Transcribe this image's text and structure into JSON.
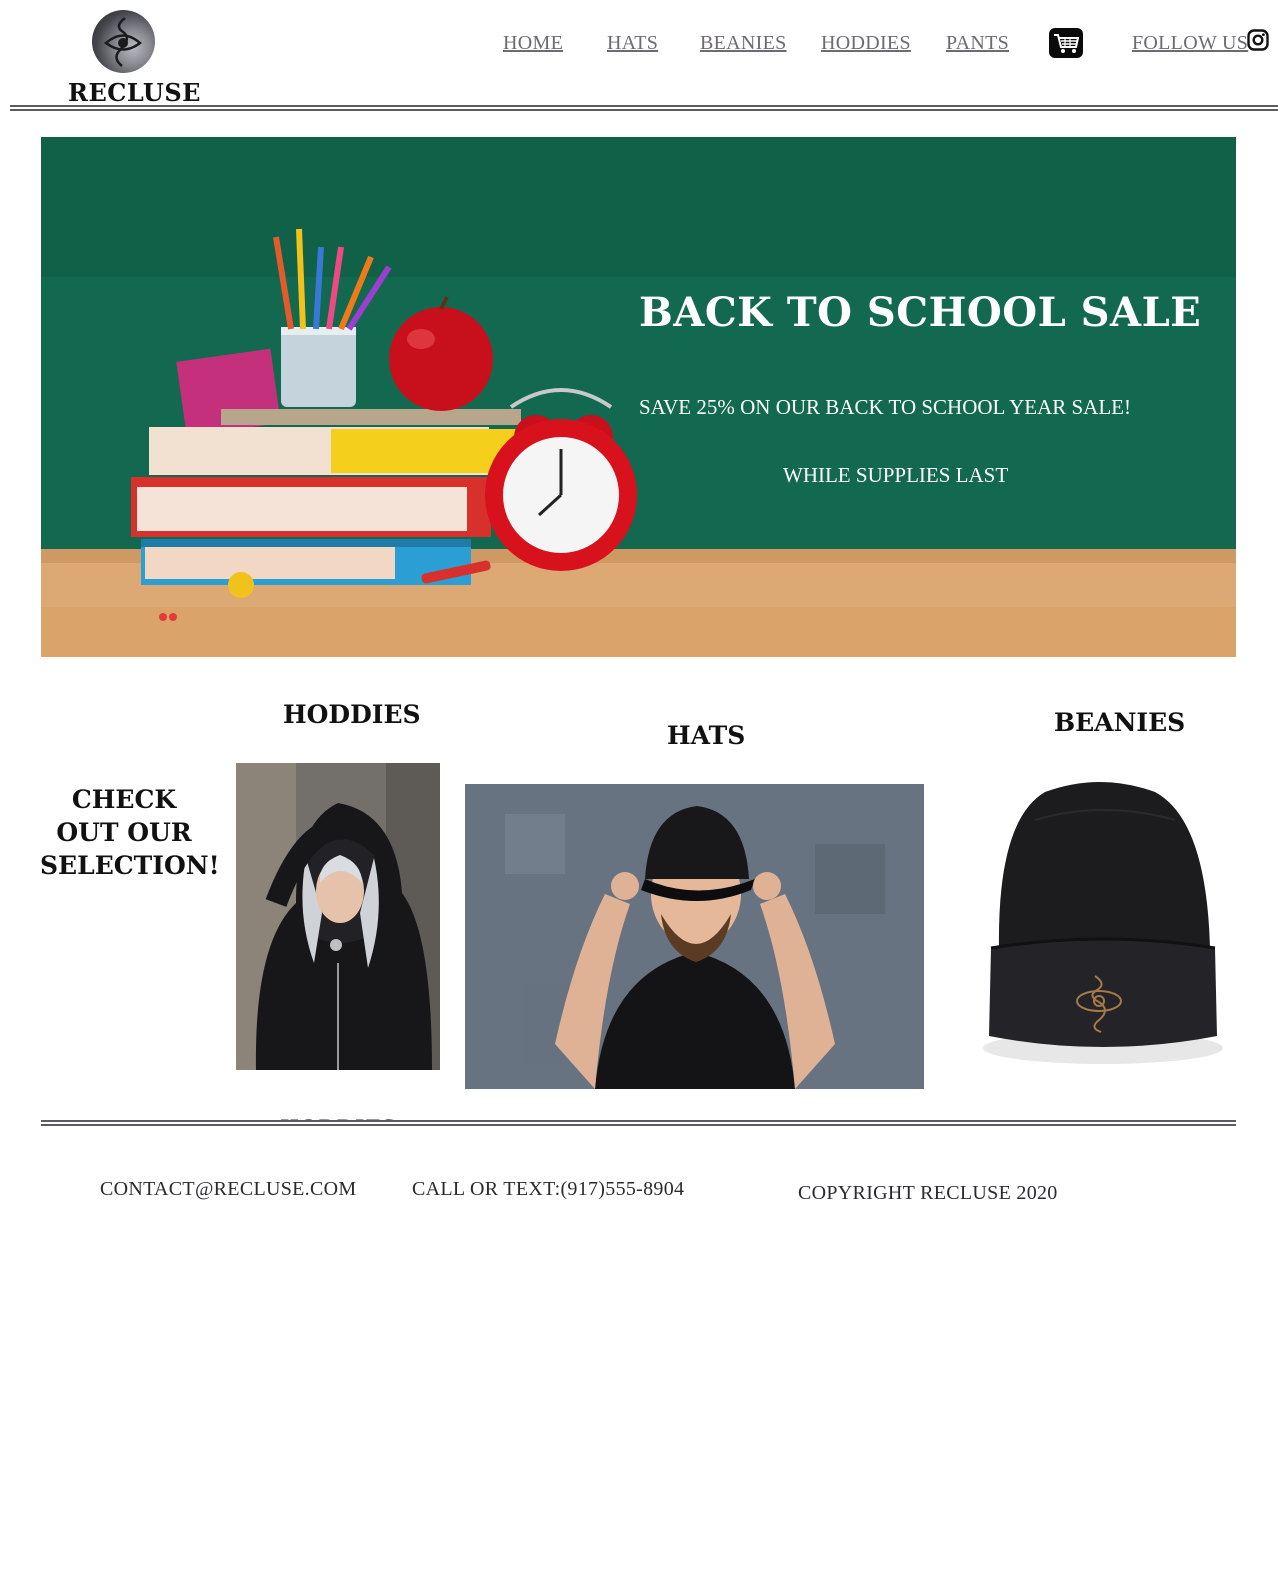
{
  "header": {
    "brand": "RECLUSE",
    "nav": [
      "HOME",
      "HATS",
      "BEANIES",
      "HODDIES",
      "PANTS"
    ],
    "follow_label": "FOLLOW US",
    "icons": {
      "logo": "eye-logo-icon",
      "cart": "shopping-cart-icon",
      "social": "instagram-icon"
    }
  },
  "hero": {
    "title": "BACK TO SCHOOL SALE",
    "subtitle": "SAVE 25% ON OUR BACK TO SCHOOL YEAR SALE!",
    "note": "WHILE SUPPLIES LAST",
    "colors": {
      "chalkboard": "#12694f",
      "desk": "#dca873"
    }
  },
  "products": {
    "cta": "CHECK OUT OUR SELECTION!",
    "categories": [
      {
        "title": "HODDIES"
      },
      {
        "title": "HATS"
      },
      {
        "title": "BEANIES"
      }
    ]
  },
  "footer": {
    "contact": "CONTACT@RECLUSE.COM",
    "phone": "CALL OR TEXT:(917)555-8904",
    "copyright": "COPYRIGHT RECLUSE 2020"
  }
}
